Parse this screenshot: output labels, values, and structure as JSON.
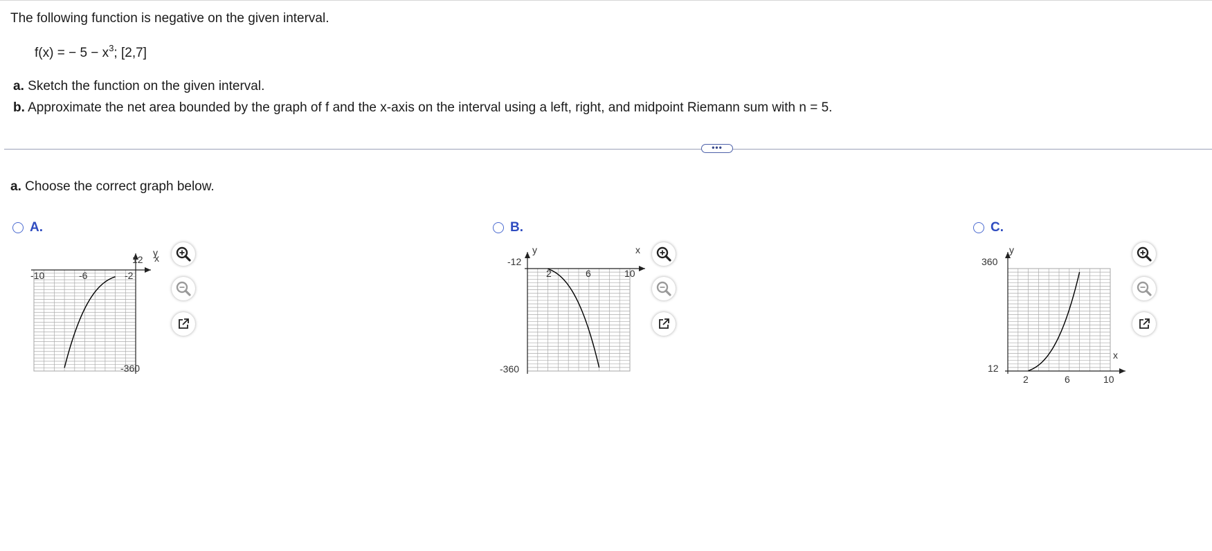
{
  "problem": {
    "intro": "The following function is negative on the given interval.",
    "function_text": "f(x) = − 5 − x",
    "function_exponent": "3",
    "function_interval": "; [2,7]",
    "part_a_label": "a.",
    "part_a_text": "Sketch the function on the given interval.",
    "part_b_label": "b.",
    "part_b_text": "Approximate the net area bounded by the graph of f and the x-axis on the interval using a left, right, and midpoint Riemann sum with n = 5."
  },
  "more_button": "•••",
  "question": {
    "label": "a.",
    "text": "Choose the correct graph below."
  },
  "choices": [
    {
      "label": "A.",
      "axis_x_name": "x",
      "axis_y_name": "y",
      "tick_labels": [
        "-10",
        "-6",
        "-2",
        "12",
        "-360"
      ]
    },
    {
      "label": "B.",
      "axis_x_name": "x",
      "axis_y_name": "y",
      "tick_labels": [
        "-12",
        "2",
        "6",
        "10",
        "-360"
      ]
    },
    {
      "label": "C.",
      "axis_x_name": "x",
      "axis_y_name": "y",
      "tick_labels": [
        "360",
        "12",
        "2",
        "6",
        "10"
      ]
    }
  ],
  "chart_data": [
    {
      "type": "line",
      "title": "",
      "xlabel": "x",
      "ylabel": "y",
      "xlim": [
        -10,
        0
      ],
      "ylim": [
        -360,
        12
      ],
      "x": [
        -7,
        -6,
        -5,
        -4,
        -3,
        -2
      ],
      "values": [
        -348,
        -221,
        -130,
        -69,
        -32,
        -13
      ],
      "grid": true
    },
    {
      "type": "line",
      "title": "",
      "xlabel": "x",
      "ylabel": "y",
      "xlim": [
        0,
        10
      ],
      "ylim": [
        -360,
        -12
      ],
      "x": [
        2,
        3,
        4,
        5,
        6,
        7
      ],
      "values": [
        -13,
        -32,
        -69,
        -130,
        -221,
        -348
      ],
      "grid": true
    },
    {
      "type": "line",
      "title": "",
      "xlabel": "x",
      "ylabel": "y",
      "xlim": [
        0,
        10
      ],
      "ylim": [
        12,
        360
      ],
      "x": [
        2,
        3,
        4,
        5,
        6,
        7
      ],
      "values": [
        13,
        32,
        69,
        130,
        221,
        348
      ],
      "grid": true
    }
  ],
  "tools": {
    "zoom_in": "zoom-in-icon",
    "zoom_out": "zoom-out-icon",
    "popout": "popout-icon",
    "accent": "#2f4cc0"
  }
}
